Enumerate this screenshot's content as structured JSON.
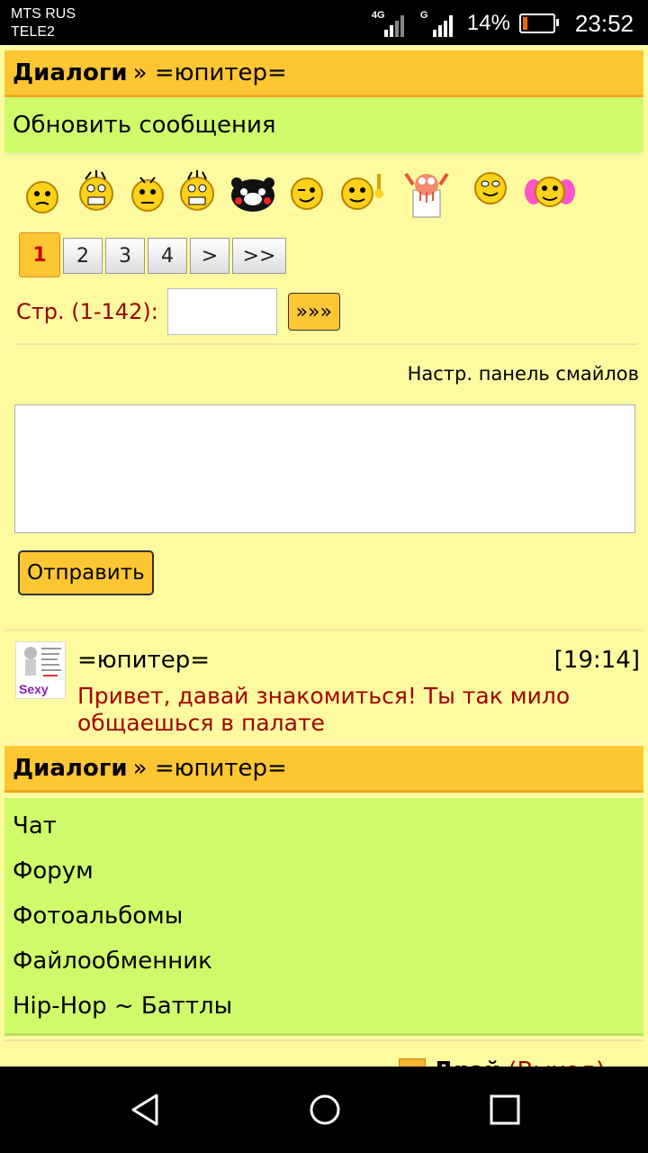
{
  "status_bar": {
    "carrier1": "MTS RUS",
    "carrier2": "TELE2",
    "net1": "4G",
    "net2": "G",
    "battery_percent": "14%",
    "time": "23:52"
  },
  "header": {
    "title_bold": "Диалоги",
    "title_rest": "» =юпитер="
  },
  "refresh_link": "Обновить сообщения",
  "smiles": [
    "smile-1",
    "smile-2",
    "smile-3",
    "smile-4",
    "smile-kumamon",
    "smile-wink",
    "smile-idea",
    "smile-zoidberg",
    "smile-happy",
    "smile-pink"
  ],
  "pagination": {
    "pages": [
      "1",
      "2",
      "3",
      "4",
      ">",
      ">>"
    ],
    "current": "1"
  },
  "page_jump": {
    "label": "Стр. (1-142):",
    "value": "",
    "go_label": "»»»"
  },
  "smiles_panel_link": "Настр. панель смайлов",
  "message_input": {
    "value": ""
  },
  "send_button": "Отправить",
  "message": {
    "author": "=юпитер=",
    "time": "[19:14]",
    "text": "Привет, давай знакомиться! Ты так мило общаешься в палате",
    "avatar_caption": "Sexy"
  },
  "header2": {
    "title_bold": "Диалоги",
    "title_rest": "» =юпитер="
  },
  "nav": [
    "Чат",
    "Форум",
    "Фотоальбомы",
    "Файлообменник",
    "Hip-Hop ~ Баттлы"
  ],
  "footer": {
    "user": "Дрэй",
    "exit": "(Выход)"
  }
}
